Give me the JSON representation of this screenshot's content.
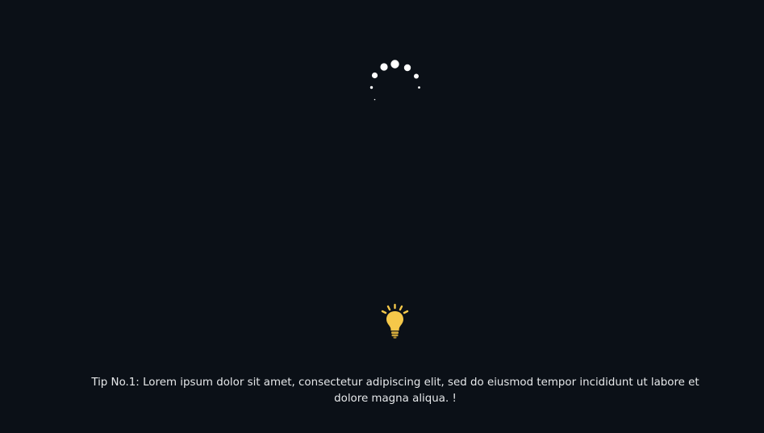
{
  "loader": {
    "spinner_icon": "loading-dots-spinner",
    "spinner_color": "#ffffff"
  },
  "tip": {
    "icon": "lightbulb-icon",
    "icon_color": "#f5c84a",
    "text": "Tip No.1: Lorem ipsum dolor sit amet, consectetur adipiscing elit, sed do eiusmod tempor incididunt ut labore et dolore magna aliqua. !"
  },
  "theme": {
    "background": "#0b1017",
    "text_color": "#e6e8ea"
  }
}
